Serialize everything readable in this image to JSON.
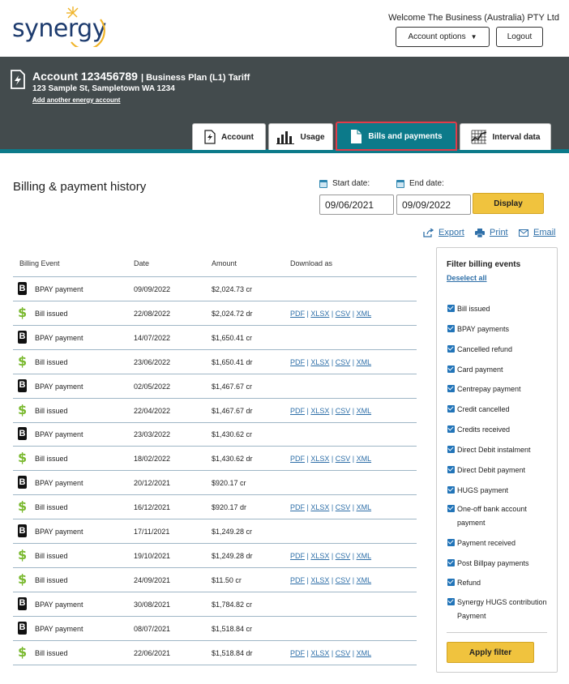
{
  "header": {
    "brand": "synergy",
    "welcome": "Welcome The Business (Australia) PTY Ltd",
    "account_options": "Account options",
    "logout": "Logout"
  },
  "account": {
    "title": "Account 123456789",
    "plan": "| Business Plan (L1) Tariff",
    "address": "123 Sample St, Sampletown WA 1234",
    "add_link": "Add another energy account"
  },
  "tabs": [
    {
      "label": "Account",
      "icon": "bill-icon",
      "active": false
    },
    {
      "label": "Usage",
      "icon": "bar-chart-icon",
      "active": false
    },
    {
      "label": "Bills and payments",
      "icon": "document-icon",
      "active": true
    },
    {
      "label": "Interval data",
      "icon": "grid-chart-icon",
      "active": false
    }
  ],
  "page": {
    "title": "Billing & payment history",
    "start_label": "Start date:",
    "end_label": "End date:",
    "start_value": "09/06/2021",
    "end_value": "09/09/2022",
    "display": "Display",
    "export": "Export",
    "print": "Print",
    "email": "Email"
  },
  "table": {
    "headers": [
      "Billing Event",
      "Date",
      "Amount",
      "Download as"
    ],
    "links": [
      "PDF",
      "XLSX",
      "CSV",
      "XML"
    ],
    "rows": [
      {
        "type": "bpay",
        "event": "BPAY payment",
        "date": "09/09/2022",
        "amount": "$2,024.73 cr"
      },
      {
        "type": "bill",
        "event": "Bill issued",
        "date": "22/08/2022",
        "amount": "$2,024.72 dr"
      },
      {
        "type": "bpay",
        "event": "BPAY payment",
        "date": "14/07/2022",
        "amount": "$1,650.41 cr"
      },
      {
        "type": "bill",
        "event": "Bill issued",
        "date": "23/06/2022",
        "amount": "$1,650.41 dr"
      },
      {
        "type": "bpay",
        "event": "BPAY payment",
        "date": "02/05/2022",
        "amount": "$1,467.67 cr"
      },
      {
        "type": "bill",
        "event": "Bill issued",
        "date": "22/04/2022",
        "amount": "$1,467.67 dr"
      },
      {
        "type": "bpay",
        "event": "BPAY payment",
        "date": "23/03/2022",
        "amount": "$1,430.62 cr"
      },
      {
        "type": "bill",
        "event": "Bill issued",
        "date": "18/02/2022",
        "amount": "$1,430.62 dr"
      },
      {
        "type": "bpay",
        "event": "BPAY payment",
        "date": "20/12/2021",
        "amount": "$920.17 cr"
      },
      {
        "type": "bill",
        "event": "Bill issued",
        "date": "16/12/2021",
        "amount": "$920.17 dr"
      },
      {
        "type": "bpay",
        "event": "BPAY payment",
        "date": "17/11/2021",
        "amount": "$1,249.28 cr"
      },
      {
        "type": "bill",
        "event": "Bill issued",
        "date": "19/10/2021",
        "amount": "$1,249.28 dr"
      },
      {
        "type": "bill",
        "event": "Bill issued",
        "date": "24/09/2021",
        "amount": "$11.50 cr"
      },
      {
        "type": "bpay",
        "event": "BPAY payment",
        "date": "30/08/2021",
        "amount": "$1,784.82 cr"
      },
      {
        "type": "bpay",
        "event": "BPAY payment",
        "date": "08/07/2021",
        "amount": "$1,518.84 cr"
      },
      {
        "type": "bill",
        "event": "Bill issued",
        "date": "22/06/2021",
        "amount": "$1,518.84 dr"
      }
    ]
  },
  "filter": {
    "title": "Filter billing events",
    "deselect": "Deselect all",
    "items": [
      "Bill issued",
      "BPAY payments",
      "Cancelled refund",
      "Card payment",
      "Centrepay payment",
      "Credit cancelled",
      "Credits received",
      "Direct Debit instalment",
      "Direct Debit payment",
      "HUGS payment",
      "One-off bank account payment",
      "Payment received",
      "Post Billpay payments",
      "Refund",
      "Synergy HUGS contribution Payment"
    ],
    "apply": "Apply filter"
  },
  "colors": {
    "band": "#434b4d",
    "teal": "#0c7a8a",
    "button_yellow": "#f0c33e",
    "link_blue": "#2e6fa8",
    "dollar_green": "#7ab92f"
  }
}
